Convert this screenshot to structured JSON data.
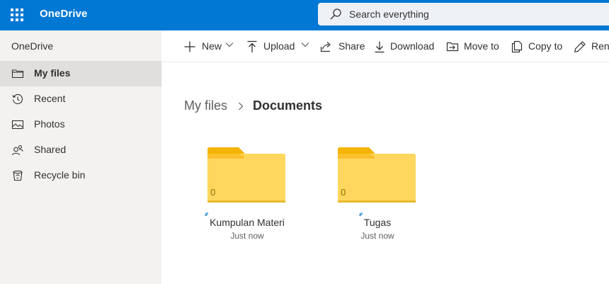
{
  "header": {
    "brand": "OneDrive",
    "search_placeholder": "Search everything",
    "accent": "#0078d4"
  },
  "sidebar": {
    "title": "OneDrive",
    "items": [
      {
        "label": "My files",
        "icon": "folder-icon",
        "selected": true
      },
      {
        "label": "Recent",
        "icon": "history-icon",
        "selected": false
      },
      {
        "label": "Photos",
        "icon": "image-icon",
        "selected": false
      },
      {
        "label": "Shared",
        "icon": "people-icon",
        "selected": false
      },
      {
        "label": "Recycle bin",
        "icon": "trash-icon",
        "selected": false
      }
    ]
  },
  "toolbar": {
    "new_label": "New",
    "upload_label": "Upload",
    "share_label": "Share",
    "download_label": "Download",
    "move_label": "Move to",
    "copy_label": "Copy to",
    "rename_label": "Rena"
  },
  "breadcrumb": {
    "root": "My files",
    "current": "Documents"
  },
  "folders": [
    {
      "name": "Kumpulan Materi",
      "modified": "Just now",
      "count": "0"
    },
    {
      "name": "Tugas",
      "modified": "Just now",
      "count": "0"
    }
  ]
}
